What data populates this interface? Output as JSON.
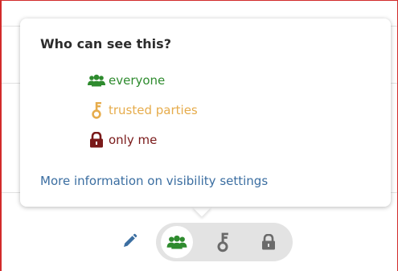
{
  "popover": {
    "title": "Who can see this?",
    "options": [
      {
        "label": "everyone",
        "icon": "group-icon",
        "color": "#2e8b2e"
      },
      {
        "label": "trusted parties",
        "icon": "key-icon",
        "color": "#e6ac4c"
      },
      {
        "label": "only me",
        "icon": "lock-icon",
        "color": "#7a1a1a"
      }
    ],
    "more_info_link": "More information on visibility settings"
  },
  "toolbar": {
    "edit_icon": "pencil-icon",
    "visibility_buttons": [
      {
        "icon": "group-icon",
        "selected": true
      },
      {
        "icon": "key-icon",
        "selected": false
      },
      {
        "icon": "lock-icon",
        "selected": false
      }
    ]
  },
  "colors": {
    "frame_border": "#d22b2b",
    "link": "#3b6ea1",
    "edit_icon": "#3b6ea1",
    "inactive_icon": "#6b6b6b",
    "pill_background": "#e3e3e3"
  }
}
